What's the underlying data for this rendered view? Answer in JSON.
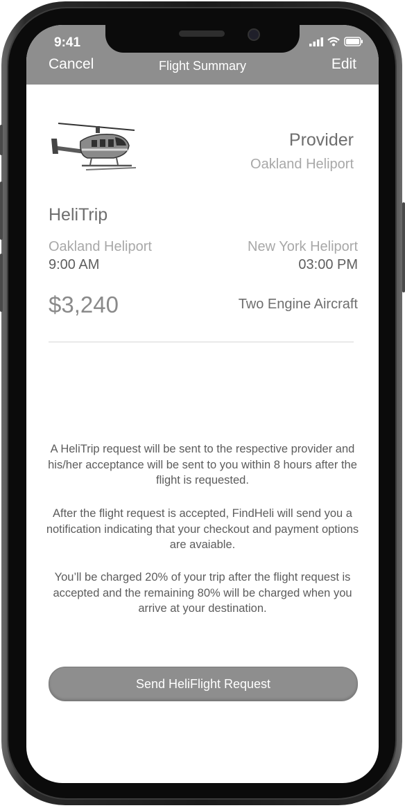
{
  "status_bar": {
    "time": "9:41",
    "icons": [
      "signal-icon",
      "wifi-icon",
      "battery-icon"
    ]
  },
  "nav": {
    "cancel_label": "Cancel",
    "title": "Flight Summary",
    "edit_label": "Edit"
  },
  "provider": {
    "title": "Provider",
    "name": "Oakland Heliport"
  },
  "trip": {
    "name": "HeliTrip",
    "from_place": "Oakland Heliport",
    "from_time": "9:00 AM",
    "to_place": "New York Heliport",
    "to_time": "03:00 PM",
    "price": "$3,240",
    "aircraft": "Two Engine Aircraft"
  },
  "info": {
    "p1": "A HeliTrip request will be sent to the respective provider and his/her acceptance will be sent to you within 8 hours after the flight is requested.",
    "p2": "After the flight request is accepted, FindHeli will send you a notification indicating that your checkout and payment options are avaiable.",
    "p3": "You’ll be charged 20% of your trip after the flight request is accepted and the remaining 80% will be charged when you arrive at your destination."
  },
  "actions": {
    "send_label": "Send HeliFlight Request"
  },
  "colors": {
    "header": "#8e8e8e",
    "button": "#8e8e8e",
    "frame": "#1a1a1a"
  }
}
